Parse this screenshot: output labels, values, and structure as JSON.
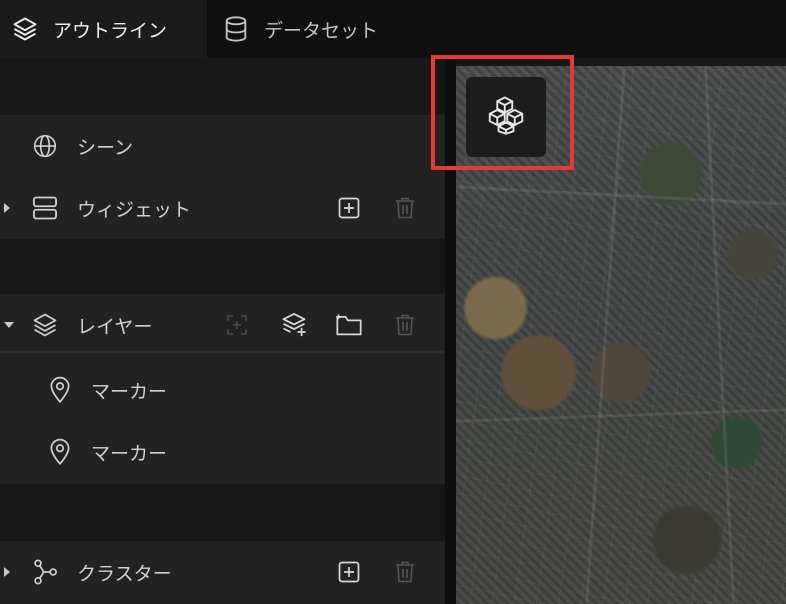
{
  "tabs": [
    {
      "label": "アウトライン",
      "icon": "layers-icon",
      "active": true
    },
    {
      "label": "データセット",
      "icon": "database-icon",
      "active": false
    }
  ],
  "outline": {
    "scene": {
      "label": "シーン",
      "icon": "globe-icon"
    },
    "widgets": {
      "label": "ウィジェット",
      "icon": "widget-icon"
    },
    "layers": {
      "label": "レイヤー",
      "icon": "layers-icon"
    },
    "markers": [
      {
        "label": "マーカー",
        "icon": "map-pin-icon"
      },
      {
        "label": "マーカー",
        "icon": "map-pin-icon"
      }
    ],
    "cluster": {
      "label": "クラスター",
      "icon": "cluster-icon"
    }
  },
  "map_button": {
    "icon": "cubes-icon"
  },
  "colors": {
    "highlight": "#e43a30",
    "panel": "#222222",
    "background": "#171717"
  }
}
